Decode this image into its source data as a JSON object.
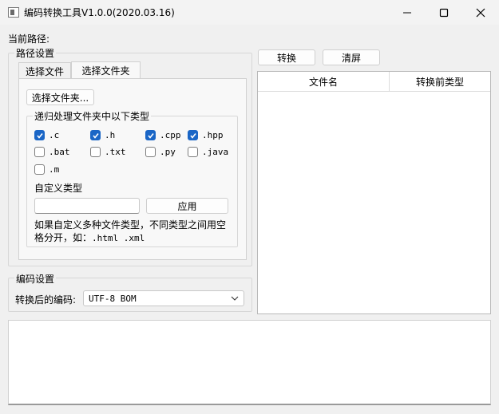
{
  "window": {
    "title": "编码转换工具V1.0.0(2020.03.16)"
  },
  "main": {
    "current_path_label": "当前路径:",
    "path_group_title": "路径设置",
    "tabs": [
      {
        "label": "选择文件"
      },
      {
        "label": "选择文件夹"
      }
    ],
    "select_folder_button": "选择文件夹...",
    "recursive_group_title": "递归处理文件夹中以下类型",
    "file_types": [
      {
        "label": ".c",
        "checked": true
      },
      {
        "label": ".h",
        "checked": true
      },
      {
        "label": ".cpp",
        "checked": true
      },
      {
        "label": ".hpp",
        "checked": true
      },
      {
        "label": ".bat",
        "checked": false
      },
      {
        "label": ".txt",
        "checked": false
      },
      {
        "label": ".py",
        "checked": false
      },
      {
        "label": ".java",
        "checked": false
      },
      {
        "label": ".m",
        "checked": false
      }
    ],
    "custom_type_label": "自定义类型",
    "custom_type_value": "",
    "apply_button": "应用",
    "hint_line1": "如果自定义多种文件类型，不同类型之间用空",
    "hint_line2_prefix": "格分开，如：",
    "hint_line2_example": ".html .xml",
    "encoding_group_title": "编码设置",
    "encoding_label": "转换后的编码:",
    "encoding_value": "UTF-8 BOM",
    "convert_button": "转换",
    "clear_button": "清屏",
    "file_table": {
      "columns": [
        "文件名",
        "转换前类型"
      ],
      "rows": []
    },
    "log_text": ""
  }
}
